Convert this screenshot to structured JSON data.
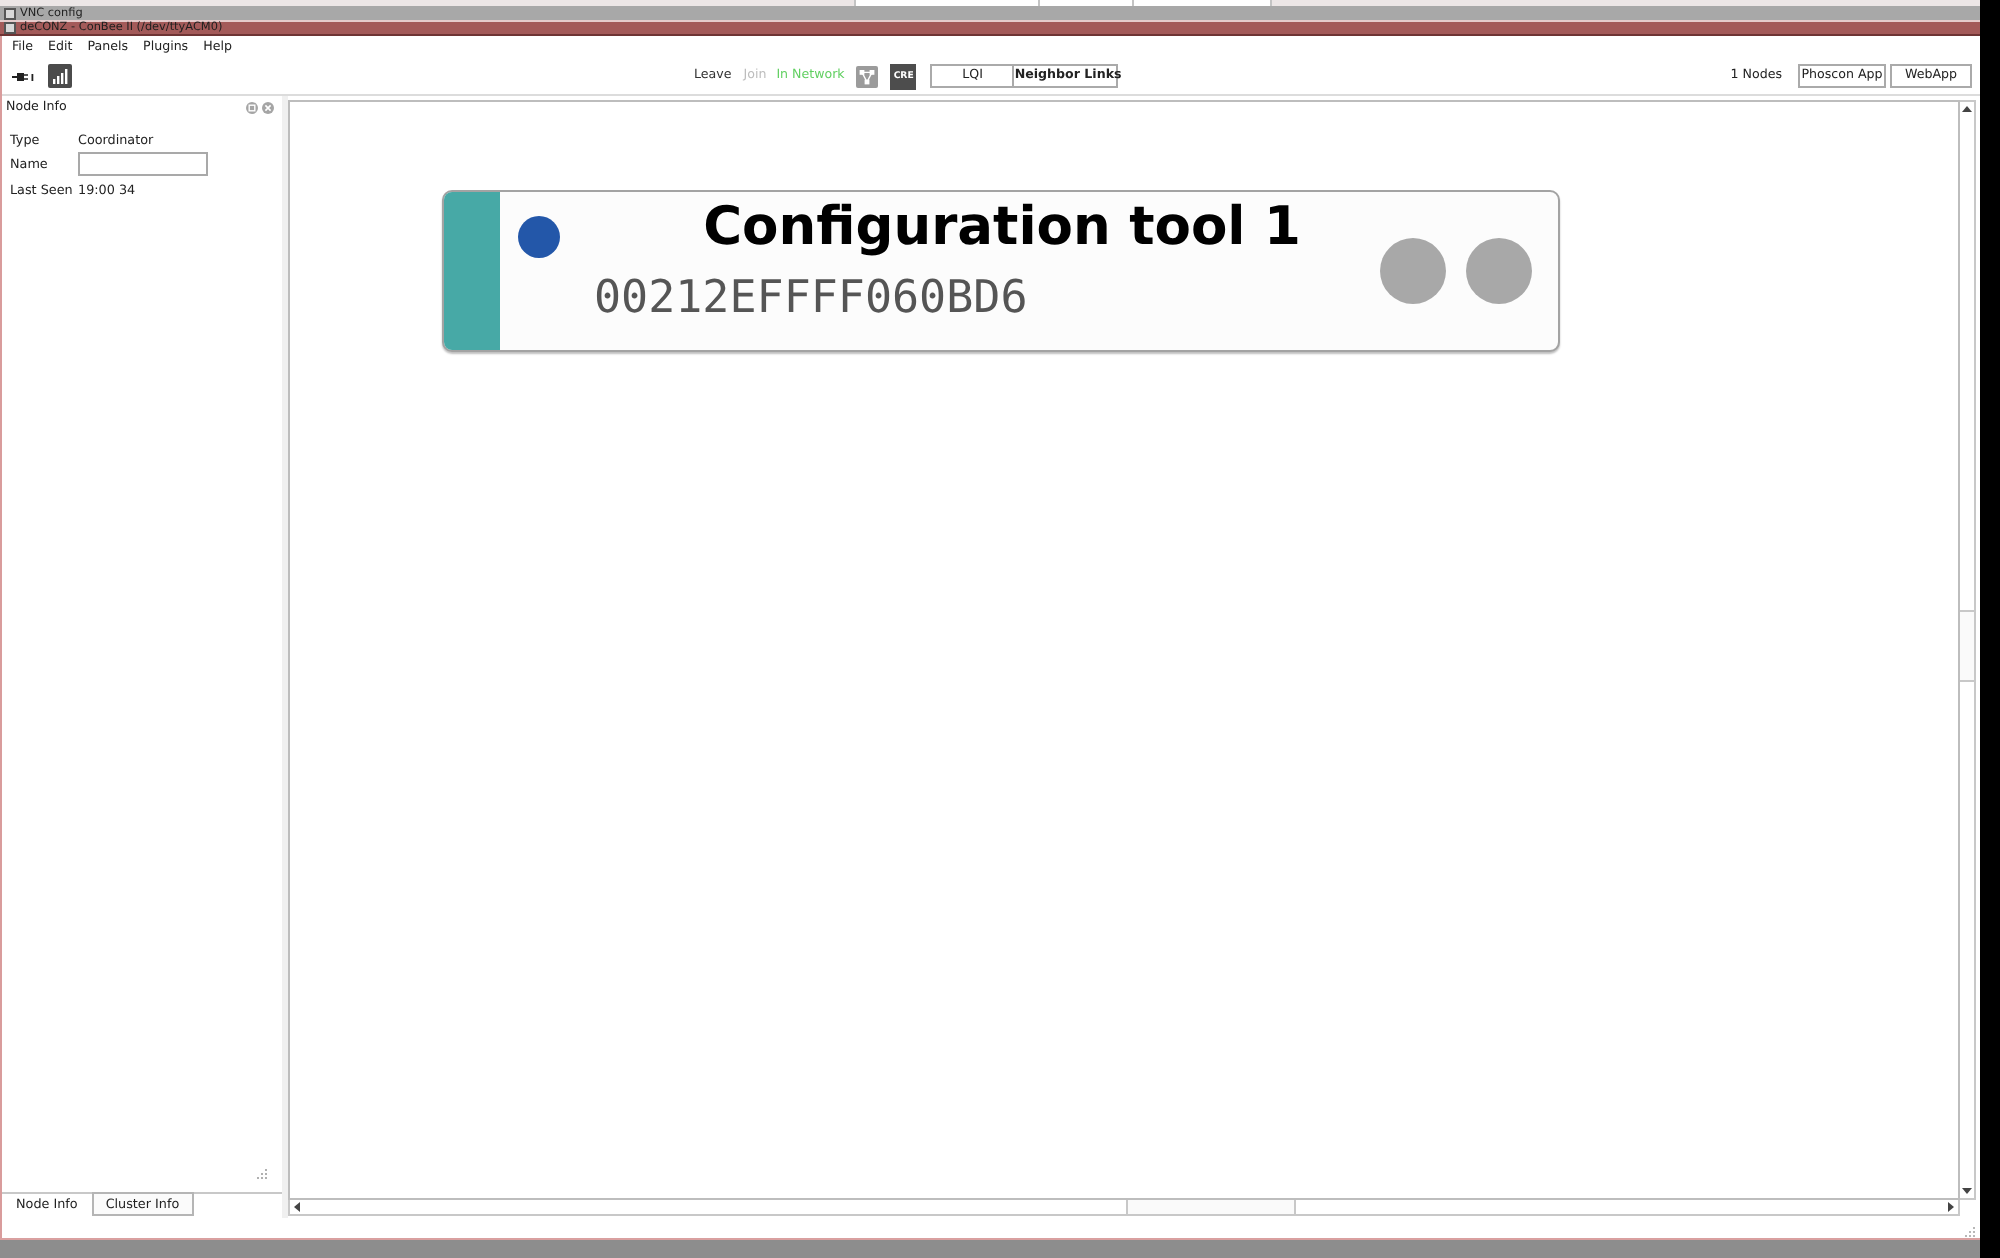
{
  "vnc_window": {
    "title": "VNC config"
  },
  "window": {
    "title": "deCONZ - ConBee II (/dev/ttyACM0)"
  },
  "menu": [
    "File",
    "Edit",
    "Panels",
    "Plugins",
    "Help"
  ],
  "toolbar": {
    "network_actions": [
      {
        "label": "Leave",
        "disabled": false
      },
      {
        "label": "Join",
        "disabled": true
      }
    ],
    "network_state": "In Network",
    "cre_button": "CRE",
    "view_buttons": [
      "LQI",
      "Neighbor Links"
    ],
    "node_count": "1 Nodes",
    "app_buttons": [
      "Phoscon App",
      "WebApp"
    ]
  },
  "node_info_panel": {
    "title": "Node Info",
    "fields": [
      {
        "kind": "text",
        "label": "Type",
        "value": "Coordinator"
      },
      {
        "kind": "input",
        "label": "Name"
      },
      {
        "kind": "text",
        "label": "Last Seen",
        "value": "19:00 34"
      }
    ],
    "tabs": [
      {
        "label": "Node Info",
        "selected": true
      },
      {
        "label": "Cluster Info",
        "selected": false
      }
    ]
  },
  "nodes": [
    {
      "name": "Configuration tool 1",
      "address": "00212EFFFF060BD6"
    }
  ]
}
